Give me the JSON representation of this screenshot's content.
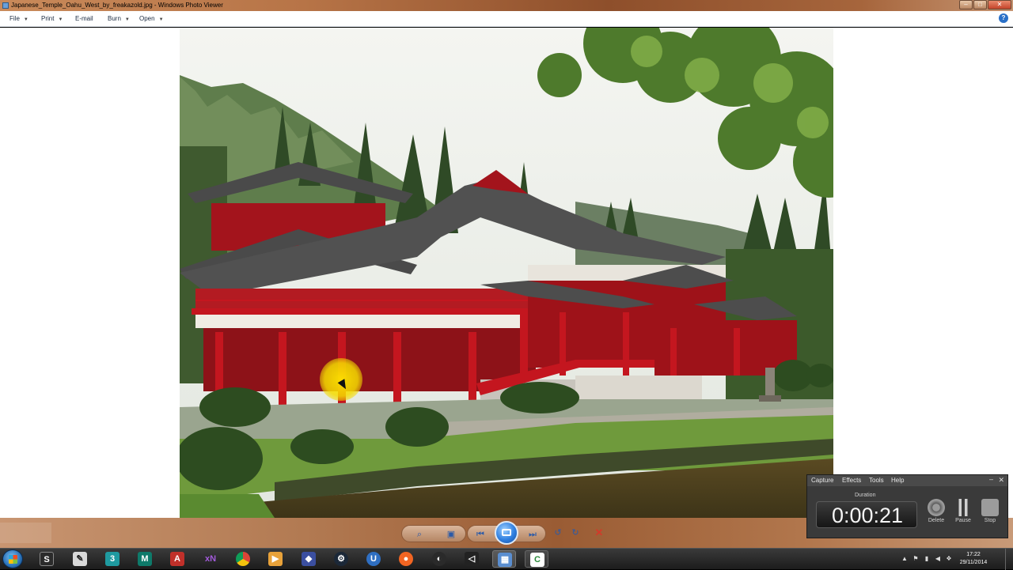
{
  "window": {
    "title": "Japanese_Temple_Oahu_West_by_freakazold.jpg - Windows Photo Viewer"
  },
  "menu": [
    {
      "label": "File",
      "has_arrow": true
    },
    {
      "label": "Print",
      "has_arrow": true
    },
    {
      "label": "E-mail",
      "has_arrow": false
    },
    {
      "label": "Burn",
      "has_arrow": true
    },
    {
      "label": "Open",
      "has_arrow": true
    }
  ],
  "help_icon": "?",
  "controls": {
    "zoom_icon": "magnifier-icon",
    "fit_icon": "actual-size-icon",
    "prev_icon": "previous-icon",
    "slideshow_icon": "slideshow-icon",
    "next_icon": "next-icon",
    "rotate_ccw_icon": "rotate-counterclockwise-icon",
    "rotate_cw_icon": "rotate-clockwise-icon",
    "delete_icon": "delete-icon"
  },
  "recorder": {
    "menu": [
      "Capture",
      "Effects",
      "Tools",
      "Help"
    ],
    "duration_label": "Duration",
    "time": "0:00:21",
    "buttons": [
      "Delete",
      "Pause",
      "Stop"
    ]
  },
  "taskbar": {
    "clock_time": "17:22",
    "clock_date": "29/11/2014"
  },
  "colors": {
    "title_bar": "#b77447",
    "control_bar": "#9a5c34",
    "temple_red": "#a3141c",
    "slideshow_blue": "#2f7fe0"
  }
}
